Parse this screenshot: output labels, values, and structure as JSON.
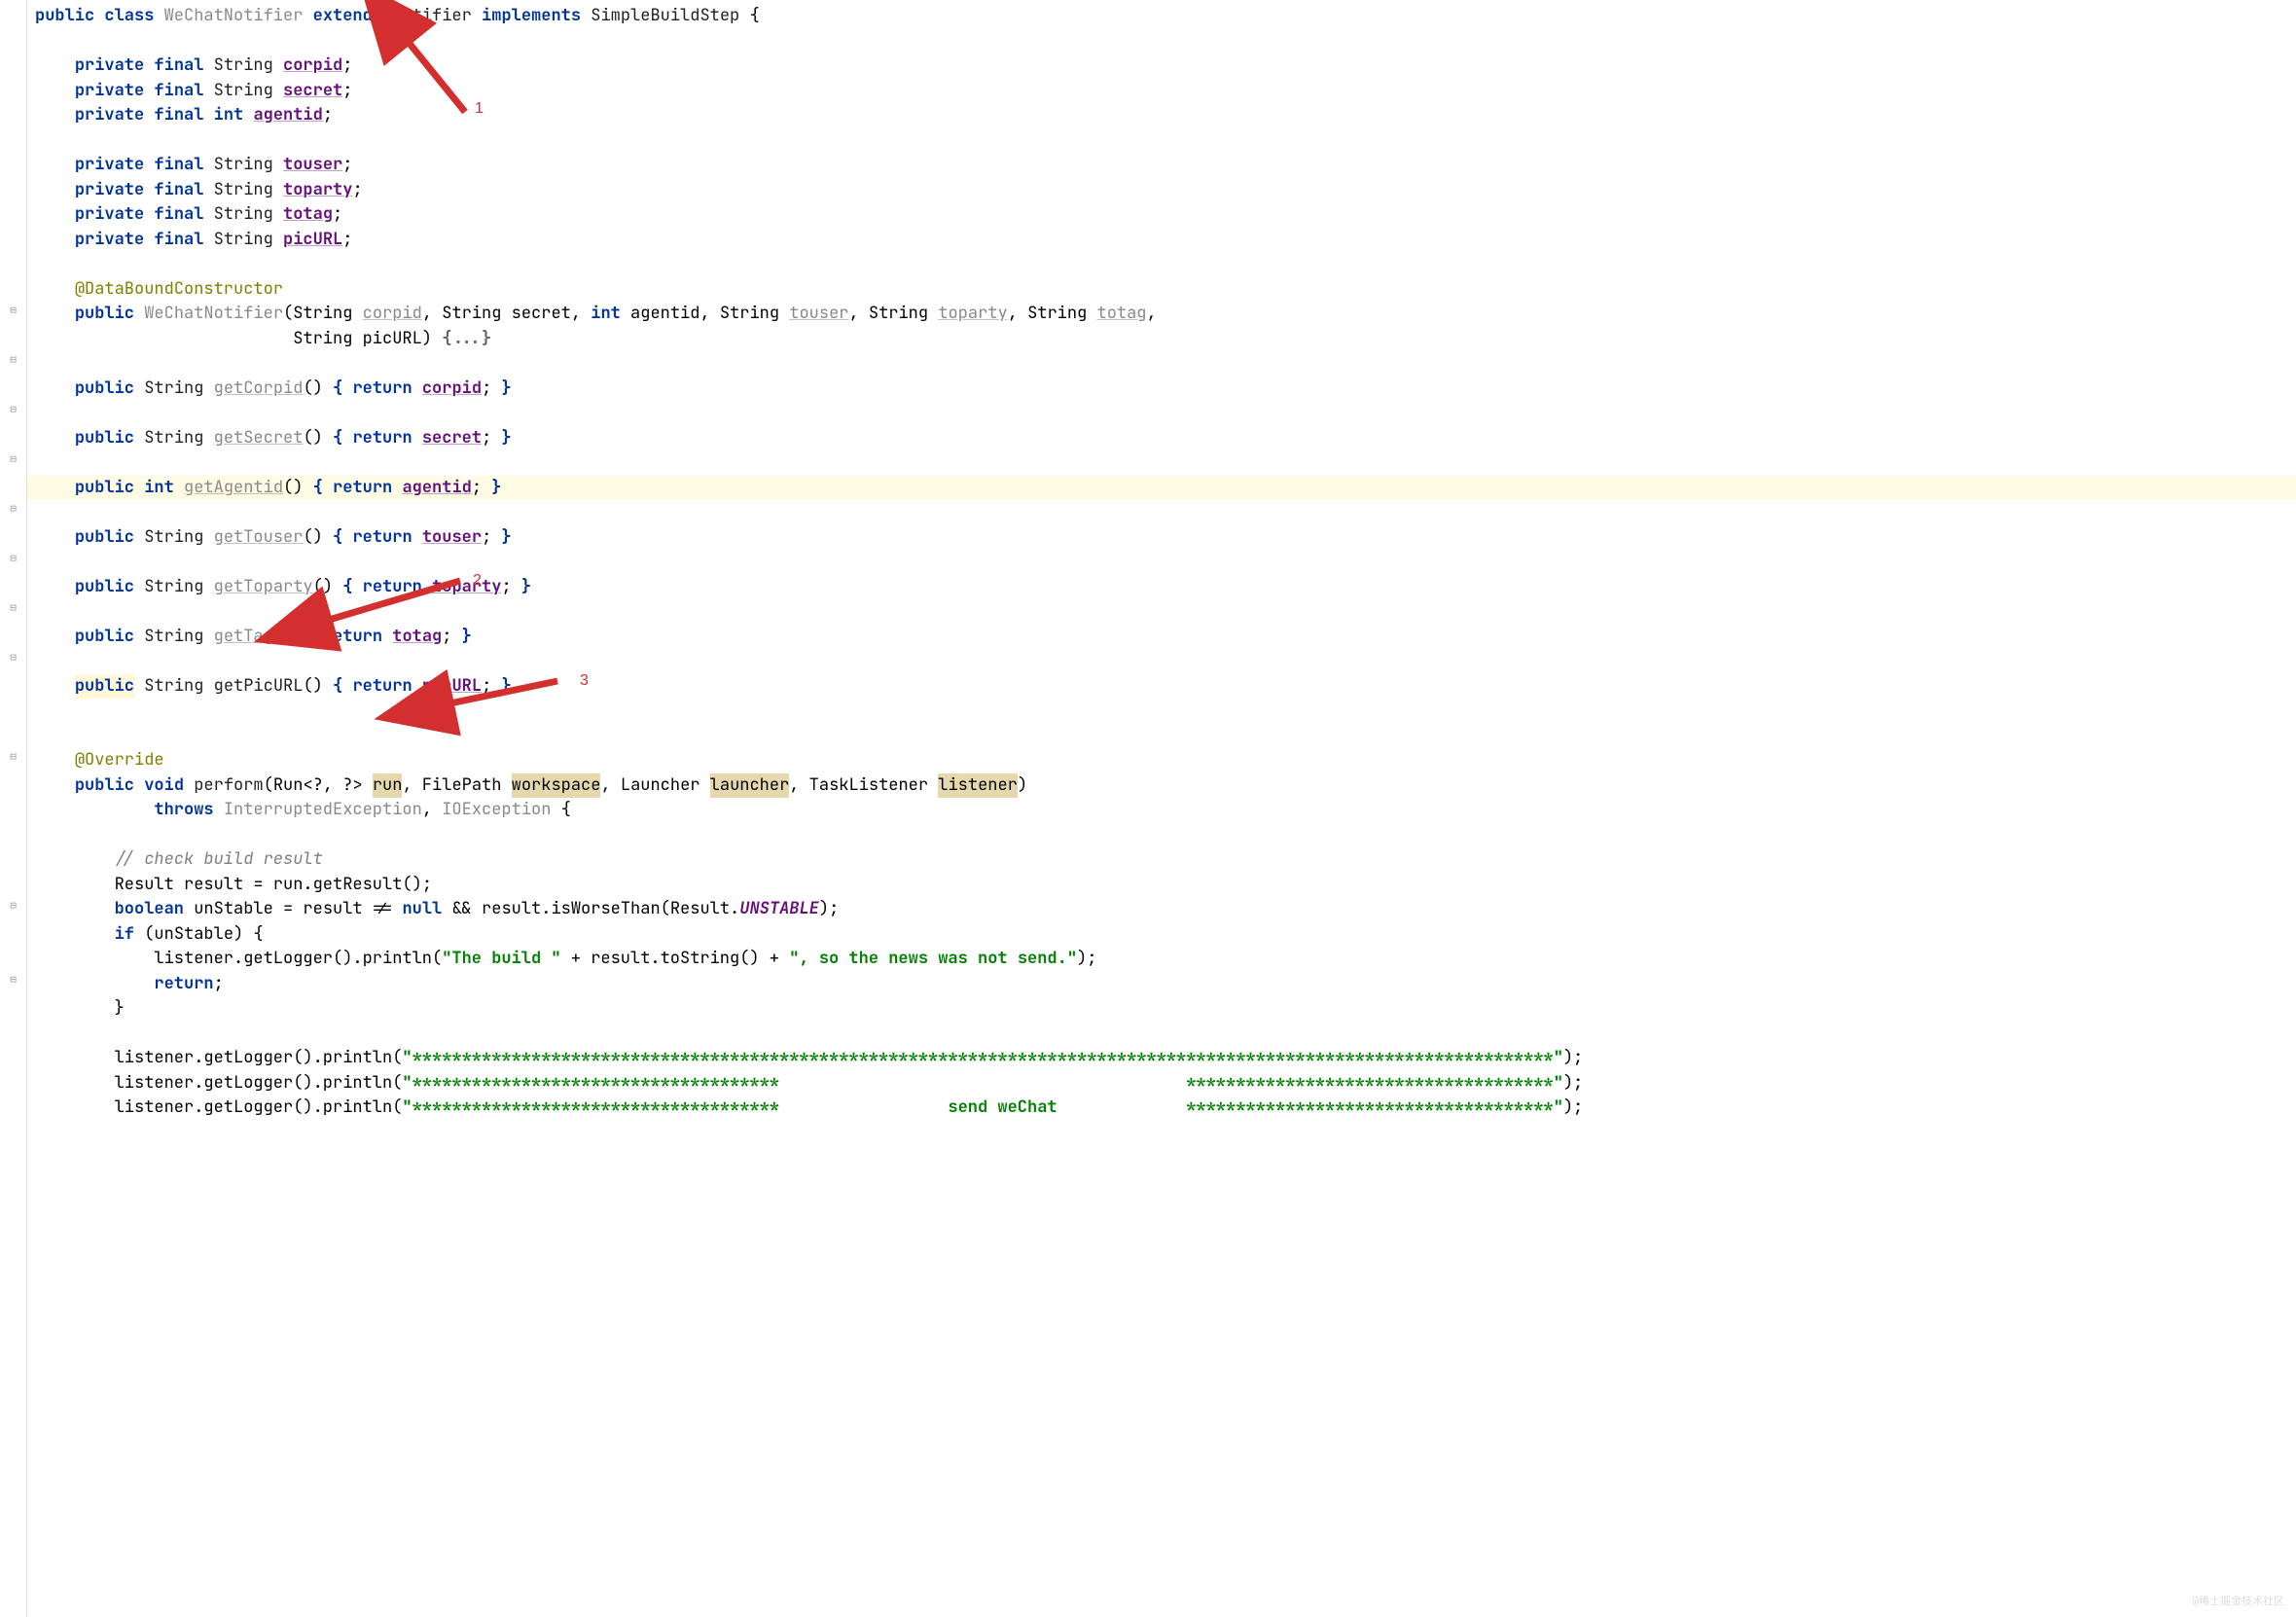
{
  "tokens": {
    "kw_public": "public",
    "kw_class": "class",
    "kw_extends": "extends",
    "kw_implements": "implements",
    "kw_private": "private",
    "kw_final": "final",
    "kw_int": "int",
    "kw_void": "void",
    "kw_return": "return",
    "kw_throws": "throws",
    "kw_boolean": "boolean",
    "kw_if": "if",
    "kw_null": "null"
  },
  "class": {
    "name": "WeChatNotifier",
    "extends": "Notifier",
    "implements": "SimpleBuildStep"
  },
  "fields": {
    "corpid": "corpid",
    "secret": "secret",
    "agentid": "agentid",
    "touser": "touser",
    "toparty": "toparty",
    "totag": "totag",
    "picURL": "picURL"
  },
  "types": {
    "String": "String",
    "int": "int",
    "Result": "Result",
    "FilePath": "FilePath",
    "Launcher": "Launcher",
    "TaskListener": "TaskListener",
    "Run": "Run"
  },
  "anno": {
    "dbc": "@DataBoundConstructor",
    "override": "@Override"
  },
  "ctor": {
    "fold": "{...}"
  },
  "getters": {
    "getCorpid": "getCorpid",
    "getSecret": "getSecret",
    "getAgentid": "getAgentid",
    "getTouser": "getTouser",
    "getToparty": "getToparty",
    "getTag": "getTag",
    "getPicURL": "getPicURL"
  },
  "perform": {
    "name": "perform",
    "params": {
      "run": "run",
      "workspace": "workspace",
      "launcher": "launcher",
      "listener": "listener"
    },
    "exc1": "InterruptedException",
    "exc2": "IOException",
    "comment1": "// check build result",
    "resultVar": "result",
    "getResult": "getResult",
    "unStable": "unStable",
    "isWorseThan": "isWorseThan",
    "UNSTABLE": "UNSTABLE",
    "getLogger": "getLogger",
    "println": "println",
    "str1": "\"The build \"",
    "toString": "toString",
    "str2": "\", so the news was not send.\"",
    "stars1": "\"*******************************************************************************************************************\"",
    "stars2": "\"*************************************                                         *************************************\"",
    "stars3": "\"*************************************                 send weChat             *************************************\""
  },
  "arrows": {
    "l1": "1",
    "l2": "2",
    "l3": "3"
  },
  "watermark": "@稀土掘金技术社区"
}
